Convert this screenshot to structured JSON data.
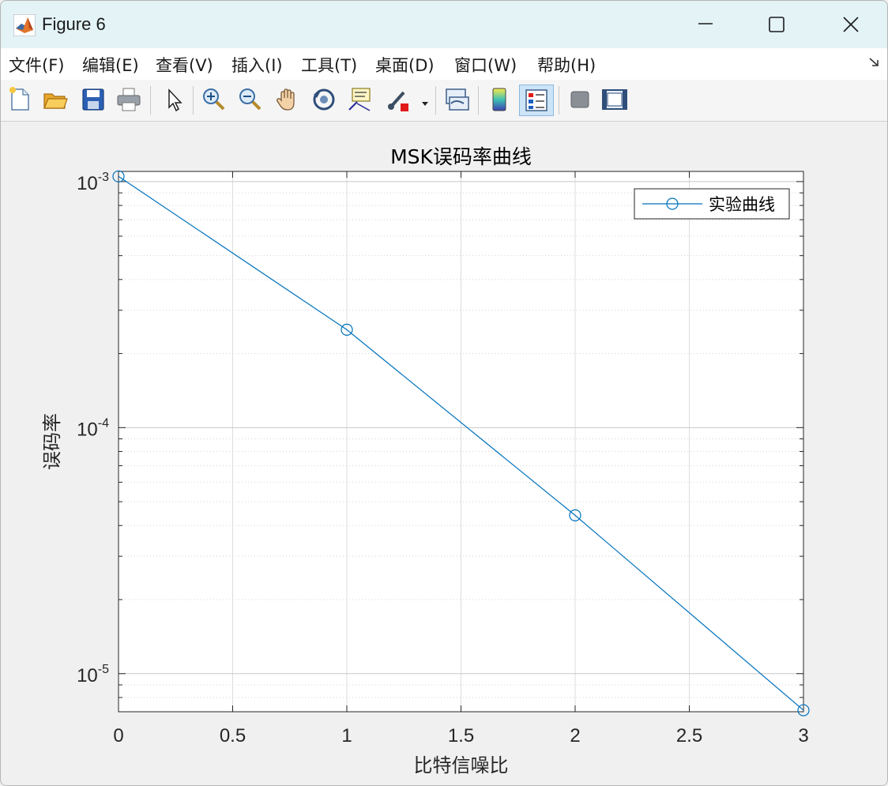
{
  "window": {
    "title": "Figure 6",
    "app_icon": "matlab-logo-icon",
    "controls": [
      "minimize-icon",
      "maximize-icon",
      "close-icon"
    ]
  },
  "menu": {
    "items": [
      "文件(F)",
      "编辑(E)",
      "查看(V)",
      "插入(I)",
      "工具(T)",
      "桌面(D)",
      "窗口(W)",
      "帮助(H)"
    ],
    "overflow_icon": "dock-arrow-icon"
  },
  "toolbar": {
    "buttons": [
      "new-figure-icon",
      "open-file-icon",
      "save-icon",
      "print-icon",
      "edit-plot-arrow-icon",
      "zoom-in-icon",
      "zoom-out-icon",
      "pan-hand-icon",
      "rotate-3d-icon",
      "data-cursor-icon",
      "brush-icon",
      "link-plot-icon",
      "colorbar-icon",
      "legend-icon",
      "hide-plot-tools-icon",
      "show-plot-tools-icon"
    ],
    "active": "legend-icon"
  },
  "chart_data": {
    "type": "line",
    "title": "MSK误码率曲线",
    "xlabel": "比特信噪比",
    "ylabel": "误码率",
    "x": [
      0,
      1,
      2,
      3
    ],
    "series": [
      {
        "name": "实验曲线",
        "values": [
          0.00105,
          0.00025,
          4.4e-05,
          7.1e-06
        ],
        "color": "#0072bd",
        "marker": "circle"
      }
    ],
    "xlim": [
      0,
      3
    ],
    "ylim": [
      7e-06,
      0.0011
    ],
    "yscale": "log",
    "xticks": [
      "0",
      "0.5",
      "1",
      "1.5",
      "2",
      "2.5",
      "3"
    ],
    "yticks": [
      {
        "base": "10",
        "exp": "-3"
      },
      {
        "base": "10",
        "exp": "-4"
      },
      {
        "base": "10",
        "exp": "-5"
      }
    ],
    "grid": true,
    "legend_position": "top-right"
  }
}
